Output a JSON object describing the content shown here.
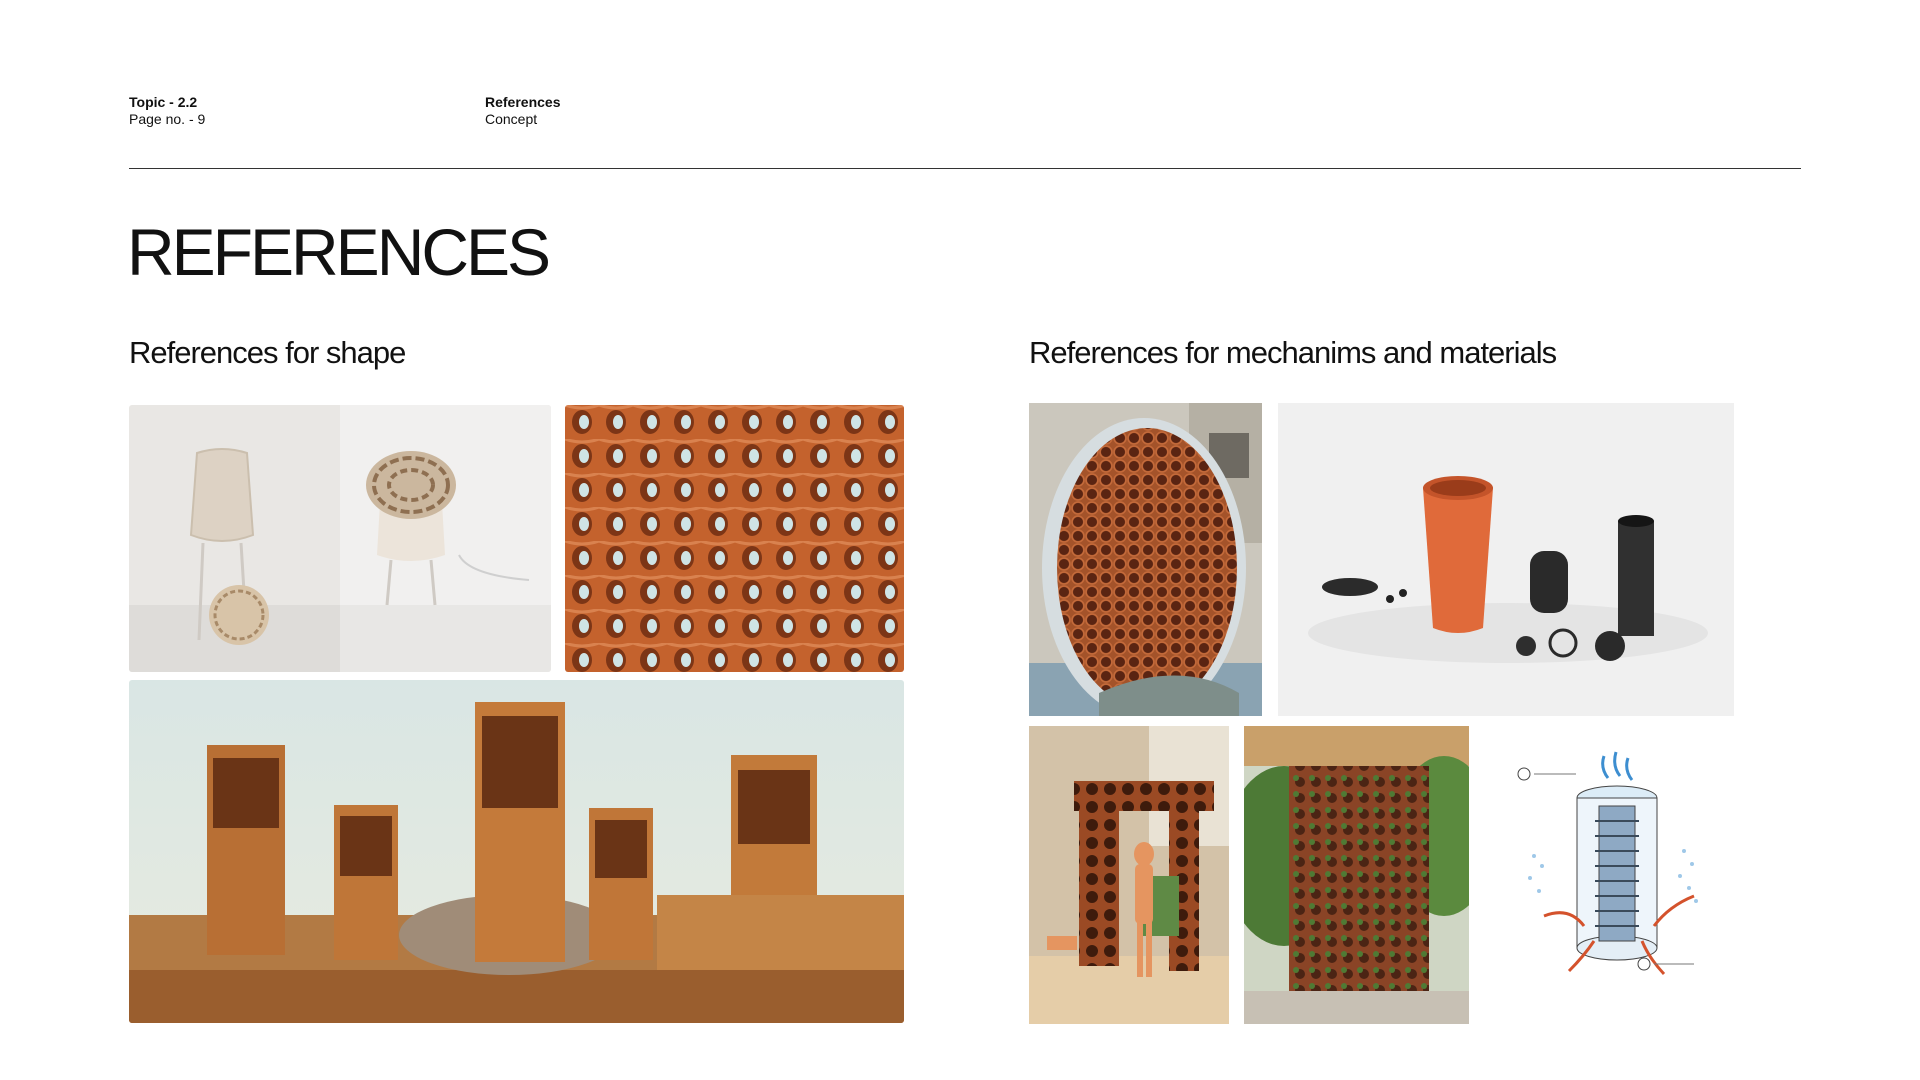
{
  "header": {
    "topic": "Topic - 2.2",
    "page": "Page no. - 9",
    "section": "References",
    "subsection": "Concept"
  },
  "title": "REFERENCES",
  "shape_heading": "References for shape",
  "mechanisms_heading": "References for mechanims and materials",
  "colors": {
    "terracotta": "#c4622d",
    "background": "#ffffff",
    "rule": "#333333"
  }
}
